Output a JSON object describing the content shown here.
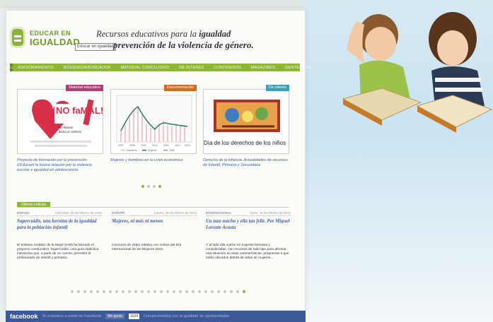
{
  "header": {
    "logo_line1": "EDUCAR EN",
    "logo_line2": "IGUALDAD",
    "logo_tooltip": "Educar en igualdad",
    "tagline_pre": "Recursos educativos para la ",
    "tagline_bold": "igualdad",
    "tagline_line2": "prevención de la violencia de género."
  },
  "nav": {
    "home_icon": "home-icon",
    "items": [
      "ASESORAMIENTO",
      "BÚSQUEDA/BUSCADOR",
      "MATERIAL CONCLUSIVO",
      "DE INTERÉS",
      "CONTENIDOS",
      "MAGAZINES",
      "GENTE/BLOG"
    ]
  },
  "cards": [
    {
      "badge": "Material educativo",
      "badge_color": "#b43a78",
      "poster_title": "NO faMAL!",
      "poster_sub1": "No llamas",
      "poster_sub2": "llama al violento",
      "caption": "Proyecto de formación por la prevención d'Educam la buena relación por la violencia escolar e igualdad en adolescencia"
    },
    {
      "badge": "Documentación",
      "badge_color": "#d46a1c",
      "caption": "Mujeres y hombres en la crisis económica"
    },
    {
      "badge": "De interés",
      "badge_color": "#3aa0b8",
      "image_caption": "Día de los derechos de los niños",
      "caption": "Derecho de la infancia. Actualidades de recursos de Infantil, Primaria y Secundaria"
    }
  ],
  "news_header": "Últimas noticias",
  "news": [
    {
      "section": "ESPAÑA",
      "date": "miércoles, 20 de febrero de 2015",
      "title": "Supercuidis, una heroína de la igualdad para la población infantil",
      "body": "El Instituto Andaluz de la Mujer (IAM) ha lanzado el proyecto coeducativo 'Supercuidis', una guía didáctica interactiva que, a partir de un cuento, permitirá al profesorado de infantil y primaria..."
    },
    {
      "section": "EUROPA",
      "date": "jueves, 19 de febrero de 2015",
      "title": "Mujeres, ni más ni menos",
      "body": "Concurso de vídeo relativo con motivo del Día Internacional de las Mujeres 2015."
    },
    {
      "section": "INTERNACIONAL",
      "date": "lunes, 16 de febrero de 2015",
      "title": "Un tazo macho y ella tan feliz. Por Miguel Lorente Acosta",
      "body": "Y al lado ella vuelve en mujeres famosas y consideradas, con recursos de todo tipo para afrontar una situación en esas características, programas a que están ubicados detrás de vidas de mujeres..."
    }
  ],
  "facebook": {
    "logo": "facebook",
    "invite": "Te invitamos a unirte en Facebook",
    "like": "Me gusta",
    "count": "1034",
    "tagline": "Comprometidos con la igualdad de oportunidades"
  },
  "chart_mini": {
    "years": [
      "2007",
      "2008",
      "2009",
      "2010",
      "2011",
      "2012",
      "2013"
    ],
    "legend": [
      "Hombres",
      "Mujeres",
      "Total"
    ]
  }
}
